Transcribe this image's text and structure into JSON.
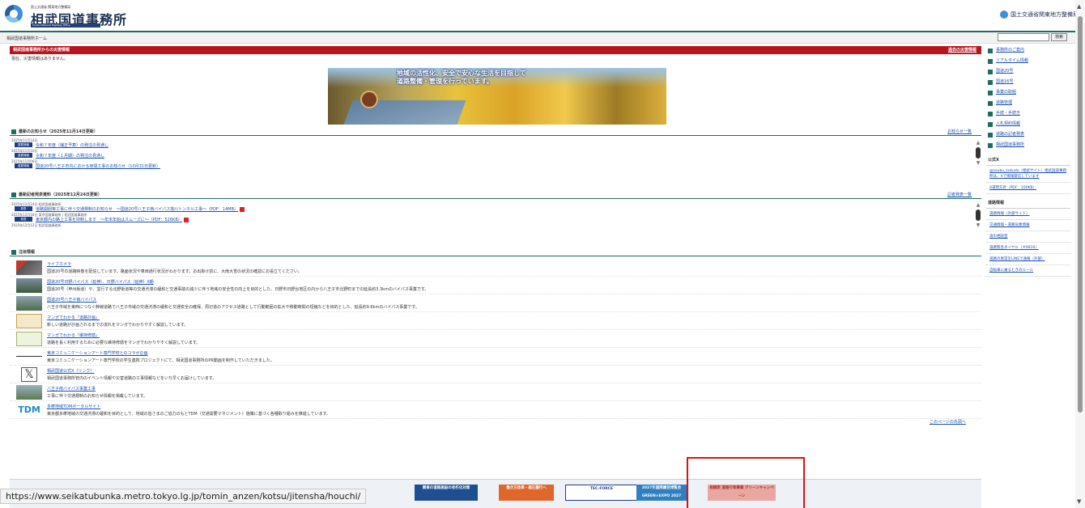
{
  "header": {
    "logo_small": "国土交通省 関東地方整備局",
    "logo_title": "相武国道事務所",
    "logo_sub": "Soubu National Highway Office",
    "mlit_label": "国土交通省関東地方整備局"
  },
  "breadcrumb": {
    "home": "相武国道事務所ホーム"
  },
  "search": {
    "button_label": "検索"
  },
  "alert": {
    "title": "相武国道事務所からの災害情報",
    "link": "過去の災害情報",
    "note": "現在、災害情報はありません。"
  },
  "banner": {
    "caption_line1": "地域の活性化、安全で安心な生活を目指して",
    "caption_line2": "道路整備・管理を行っています。"
  },
  "news": {
    "heading": "最新のお知らせ（2025年11月14日更新）",
    "more": "お知らせ一覧",
    "items": [
      {
        "date": "2025年11月14日",
        "tag": "重要情報",
        "title": "令和７年度（補正予算）の発注の見通し"
      },
      {
        "date": "2025年11月10日",
        "tag": "重要情報",
        "title": "令和７年度（１月期）の発注の見通し"
      },
      {
        "date": "2025年11月06日",
        "tag": "重要情報",
        "title": "国道20号八王子市内における夜間工事のお知らせ（10月31日更新）"
      }
    ]
  },
  "press": {
    "heading": "最新記者発表資料（2025年12月24日更新）",
    "more": "記者発表一覧",
    "items": [
      {
        "date": "2025年12月24日 相武国道事務所",
        "tag": "発表",
        "title": "道路開削等工事に伴う交通規制のお知らせ　～国道20号八王子南バイパス落川トンネル工事～（PDF：14MB）"
      },
      {
        "date": "2025年12月18日 東京国道事務所 / 相武国道事務所",
        "tag": "発表",
        "title": "東京都内の路上工事を抑制します　～年末年始はスムーズに～（PDF：526KB）"
      },
      {
        "date": "2025年12月12日 相武国道事務所",
        "tag": "発表",
        "title": ""
      }
    ]
  },
  "caution": {
    "heading": "注目情報",
    "items": [
      {
        "title": "ライブカメラ",
        "desc": "国道20号の道路映像を配信しています。路面状況や車両通行状況がわかります。お出掛け前に、大雨大雪の状況の確認にお役立てください。"
      },
      {
        "title": "国道20号日野バイパス（延伸）、日野バイパス（延伸）II期",
        "desc": "国道20号（甲州街道）や、並行する北野街道等の交通渋滞の緩和と交通事故の減少に伴う地域の安全性の向上を目的とした、日野市日野台地区の内から八王子市北野町までの延長約3.3kmのバイパス事業です。"
      },
      {
        "title": "国道20号八王子南バイパス",
        "desc": "八王子市域を東西につなぐ幹線道路で八王子市域の交通渋滞の緩和と交通安全の確保、周辺道のアクセス道路として行動範囲の拡大や移動時間の短縮などを目的とした、延長約9.6kmのバイパス事業です。"
      },
      {
        "title": "マンガでわかる『道路計画』",
        "desc": "新しい道路が計画されるまでの流れをマンガでわかりやすく解説しています。"
      },
      {
        "title": "マンガでわかる『維持修繕』",
        "desc": "道路を長く利用するために必要な維持修繕をマンガでわかりやすく解説しています。"
      },
      {
        "title": "東京コミュニケーションアート専門学校とのコラボ企画",
        "desc": "東京コミュニケーションアート専門学校の学生連携プロジェクトにて、相武国道事務所のPR動画を制作していただきました。"
      },
      {
        "title": "相武国道公式X（リンク）",
        "desc": "相武国道事務所管内のイベント情報や災害道路の工事情報などをいち早くお届けしています。"
      },
      {
        "title": "八王子南バイパス事業工事",
        "desc": "工事に伴う交通規制のお知らせ情報を掲載しています。"
      },
      {
        "title": "多摩地域TDMポータルサイト",
        "desc": "東京都多摩地域の交通渋滞の緩和を目的として、地域の皆さまのご協力のもとTDM（交通需要マネジメント）施策に基づく各種取り組みを推進しています。"
      }
    ]
  },
  "pagetop": "このページの先頭へ",
  "footer": {
    "banners": [
      "関東の道路施設の老朽化対策",
      "働き方改革・適正履行へ",
      "TEC-FORCE",
      "2027年国際園芸博覧会 GREEN×EXPO 2027",
      "相模原 道路行政事業 グリーンキャンペーン"
    ],
    "colors": [
      "#1d4f91",
      "#e0672b",
      "#1d3f8a",
      "#2f7fc1",
      "#e9a7a1"
    ]
  },
  "status_url": "https://www.seikatubunka.metro.tokyo.lg.jp/tomin_anzen/kotsu/jitensha/houchi/",
  "sidebar": {
    "links": [
      "事務所のご案内",
      "リアルタイム情報",
      "国道20号",
      "国道16号",
      "事業の取組",
      "道路管理",
      "手続・手続き",
      "入札契約情報",
      "道路の記者発表",
      "相武国道事務所"
    ],
    "official_heading": "公式X",
    "official_items": [
      "@soubu_kokudo（相武サイト）相武国道事務所は、Xで情報発信しています",
      "X運用方針（PDF：100KB）"
    ],
    "road_heading": "道路情報",
    "road_items": [
      "道路情報（外部サイト）",
      "交通情報・道路気象情報",
      "道の相談室",
      "道路緊急ダイヤル（＃9910）",
      "道路の異常をLINEで通報（外部）",
      "自転車に乗るときのルール"
    ]
  },
  "colors": {
    "accent": "#1f6c63",
    "alert": "#b8141b",
    "link": "#1a4fb5",
    "tag": "#1d3f8a"
  }
}
